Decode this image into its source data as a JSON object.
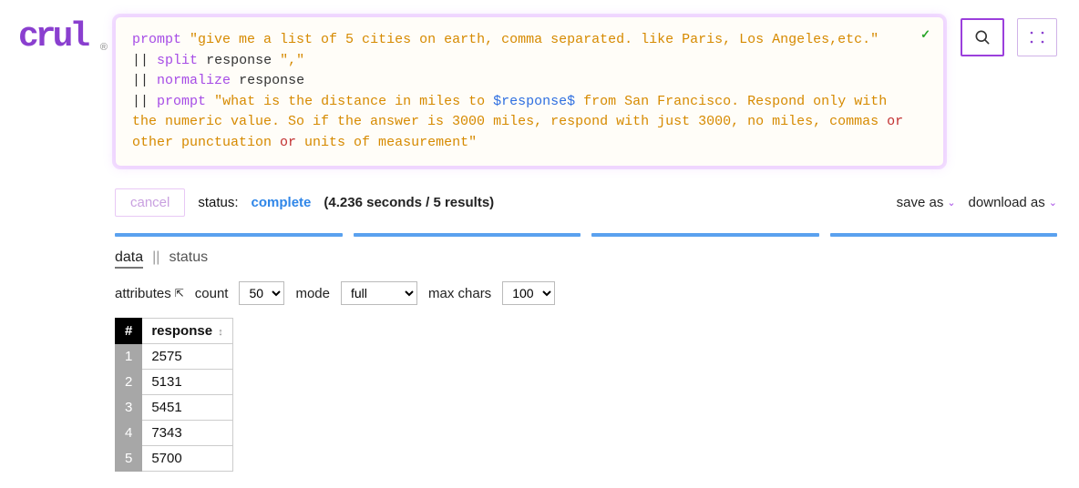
{
  "logo": {
    "text": "crul",
    "registered": "®"
  },
  "query": {
    "line1_kw": "prompt",
    "line1_str": "\"give me a list of 5 cities on earth, comma separated. like Paris, Los Angeles,etc.\"",
    "line2_pipe": "||",
    "line2_kw": "split",
    "line2_arg1": "response",
    "line2_arg2": "\",\"",
    "line3_pipe": "||",
    "line3_kw": "normalize",
    "line3_arg": "response",
    "line4_pipe": "||",
    "line4_kw": "prompt",
    "line4_str_a": "\"what is the distance in miles to ",
    "line4_var": "$response$",
    "line4_str_b": " from San Francisco. Respond only with the numeric value. So if the answer is 3000 miles, respond with just 3000, no miles, commas ",
    "line4_op1": "or",
    "line4_str_c": " other punctuation ",
    "line4_op2": "or",
    "line4_str_d": " units of measurement\"",
    "checkmark": "✓"
  },
  "status": {
    "cancel": "cancel",
    "label": "status:",
    "value": "complete",
    "timing": "(4.236 seconds / 5 results)",
    "saveas": "save as",
    "downloadas": "download as"
  },
  "tabs": {
    "data": "data",
    "sep": "||",
    "status": "status"
  },
  "controls": {
    "attributes": "attributes",
    "count_label": "count",
    "count_value": "50",
    "mode_label": "mode",
    "mode_value": "full",
    "maxchars_label": "max chars",
    "maxchars_value": "100"
  },
  "table": {
    "idx_header": "#",
    "col_header": "response",
    "rows": [
      {
        "n": "1",
        "v": "2575"
      },
      {
        "n": "2",
        "v": "5131"
      },
      {
        "n": "3",
        "v": "5451"
      },
      {
        "n": "4",
        "v": "7343"
      },
      {
        "n": "5",
        "v": "5700"
      }
    ]
  }
}
